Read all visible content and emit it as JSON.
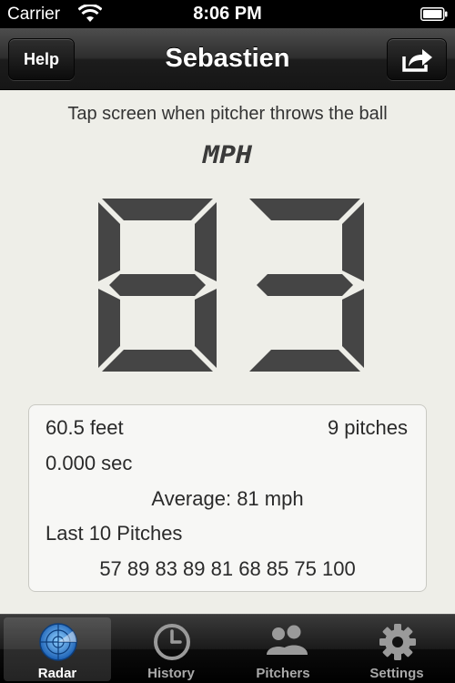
{
  "status_bar": {
    "carrier": "Carrier",
    "time": "8:06 PM"
  },
  "nav": {
    "help_label": "Help",
    "title": "Sebastien",
    "share_icon": "share-icon"
  },
  "main": {
    "instruction": "Tap screen when pitcher throws the ball",
    "unit": "MPH",
    "speed": "83"
  },
  "stats": {
    "distance": "60.5 feet",
    "pitch_count": "9 pitches",
    "elapsed": "0.000 sec",
    "average": "Average: 81 mph",
    "last_title": "Last 10 Pitches",
    "last_values": "57 89 83 89 81 68 85 75 100"
  },
  "tabs": [
    {
      "label": "Radar",
      "icon": "radar-icon",
      "active": true
    },
    {
      "label": "History",
      "icon": "clock-icon",
      "active": false
    },
    {
      "label": "Pitchers",
      "icon": "people-icon",
      "active": false
    },
    {
      "label": "Settings",
      "icon": "gear-icon",
      "active": false
    }
  ],
  "colors": {
    "digit": "#454545",
    "nav_bg": "#2a2a2a",
    "screen_bg": "#eeeee8",
    "accent_blue": "#3f8ad6"
  }
}
